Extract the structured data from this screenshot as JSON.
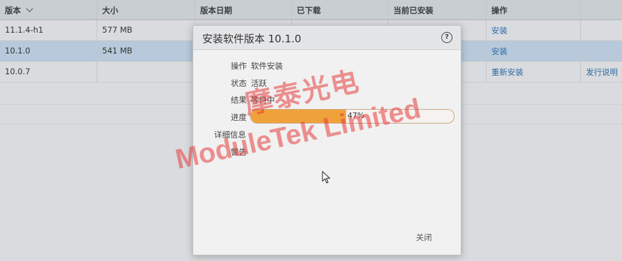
{
  "table": {
    "headers": [
      "版本",
      "大小",
      "版本日期",
      "已下载",
      "当前已安装",
      "操作",
      ""
    ],
    "rows": [
      {
        "version": "11.1.4-h1",
        "size": "577 MB",
        "action": "安装",
        "extra": ""
      },
      {
        "version": "10.1.0",
        "size": "541 MB",
        "action": "安装",
        "extra": "",
        "selected": true
      },
      {
        "version": "10.0.7",
        "size": "",
        "action": "重新安装",
        "extra": "发行说明"
      }
    ]
  },
  "dialog": {
    "title": "安装软件版本 10.1.0",
    "help_icon": "help-circle-icon",
    "operation_label": "操作",
    "operation_value": "软件安装",
    "status_label": "状态",
    "status_value": "活跃",
    "result_label": "结果",
    "result_value": "等待中",
    "progress_label": "进度",
    "progress_value": 0.47,
    "progress_text": "47%",
    "details_label": "详细信息",
    "warning_label": "警告",
    "close_label": "关闭"
  },
  "watermark": {
    "chinese": "摩泰光电",
    "english": "ModuleTek Limited"
  },
  "colors": {
    "progress_fill": "#f0a23a",
    "link": "#2f6aa3",
    "selected_row": "#b7c9da",
    "watermark": "#e63c3c"
  }
}
